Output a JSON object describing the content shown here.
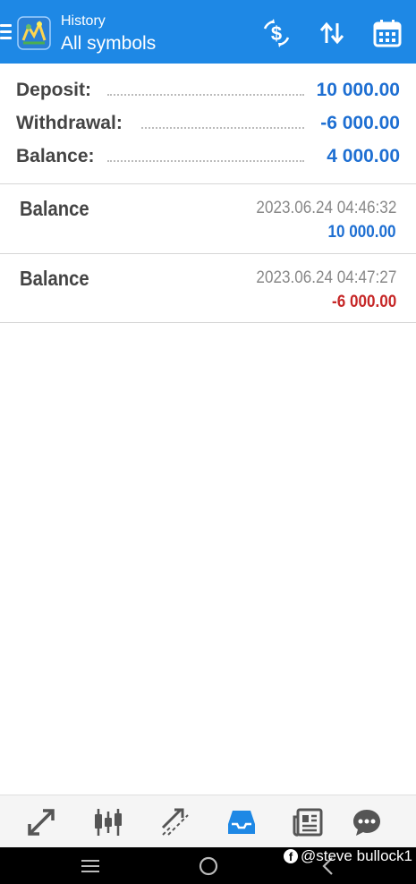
{
  "appbar": {
    "title_small": "History",
    "title_large": "All symbols",
    "actions": [
      "currency-exchange-icon",
      "sort-icon",
      "calendar-icon"
    ]
  },
  "summary": {
    "deposit_label": "Deposit:",
    "deposit_value": "10 000.00",
    "withdrawal_label": "Withdrawal:",
    "withdrawal_value": "-6 000.00",
    "balance_label": "Balance:",
    "balance_value": "4 000.00"
  },
  "deals": [
    {
      "type": "Balance",
      "time": "2023.06.24 04:46:32",
      "amount": "10 000.00",
      "amount_color": "#1e6fd2"
    },
    {
      "type": "Balance",
      "time": "2023.06.24 04:47:27",
      "amount": "-6 000.00",
      "amount_color": "#c62828"
    }
  ],
  "bottom_nav": {
    "items": [
      "quotes-icon",
      "chart-icon",
      "trade-icon",
      "history-icon",
      "news-icon",
      "messages-icon"
    ],
    "active": "history-icon",
    "active_color": "#1e88e5",
    "inactive_color": "#555555"
  },
  "system_nav": {
    "watermark": "@steve bullock1"
  },
  "colors": {
    "accent": "#1e88e5",
    "positive": "#1e6fd2",
    "negative": "#c62828"
  }
}
